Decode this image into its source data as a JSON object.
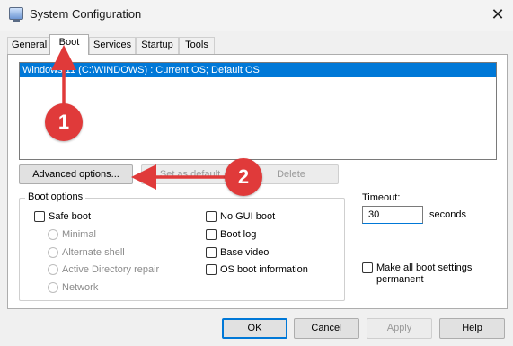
{
  "window": {
    "title": "System Configuration",
    "close_glyph": "✕"
  },
  "tabs": [
    {
      "label": "General"
    },
    {
      "label": "Boot"
    },
    {
      "label": "Services"
    },
    {
      "label": "Startup"
    },
    {
      "label": "Tools"
    }
  ],
  "boot": {
    "os_entries": [
      "Windows 11 (C:\\WINDOWS) : Current OS; Default OS"
    ],
    "advanced_options_label": "Advanced options...",
    "set_default_label": "Set as default",
    "delete_label": "Delete",
    "boot_options": {
      "group_label": "Boot options",
      "safe_boot": "Safe boot",
      "minimal": "Minimal",
      "alternate_shell": "Alternate shell",
      "active_directory_repair": "Active Directory repair",
      "network": "Network",
      "no_gui_boot": "No GUI boot",
      "boot_log": "Boot log",
      "base_video": "Base video",
      "os_boot_information": "OS boot information"
    },
    "timeout": {
      "label": "Timeout:",
      "value": "30",
      "unit": "seconds"
    },
    "make_permanent": "Make all boot settings permanent"
  },
  "buttons": {
    "ok": "OK",
    "cancel": "Cancel",
    "apply": "Apply",
    "help": "Help"
  },
  "annotations": [
    {
      "number": "1",
      "color": "#e03a3a"
    },
    {
      "number": "2",
      "color": "#e03a3a"
    }
  ],
  "colors": {
    "selection": "#0078d7",
    "annotation": "#e03a3a"
  }
}
